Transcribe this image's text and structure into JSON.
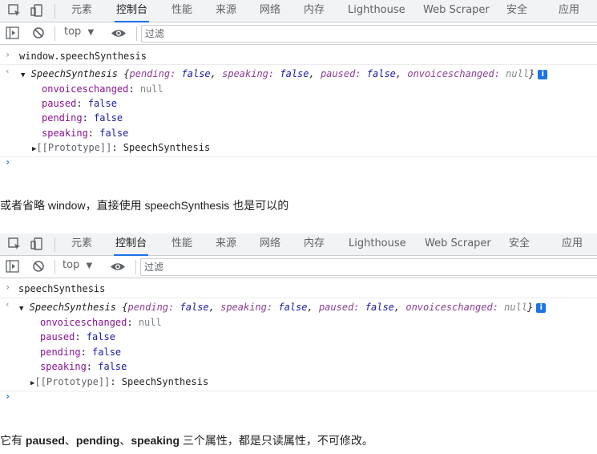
{
  "panels": [
    {
      "tabs": [
        "元素",
        "控制台",
        "性能",
        "来源",
        "网络",
        "内存",
        "Lighthouse",
        "Web Scraper",
        "安全",
        "应用"
      ],
      "active_tab": "控制台",
      "context": "top",
      "filter_placeholder": "过滤",
      "input": "window.speechSynthesis",
      "summary": {
        "class": "SpeechSynthesis",
        "open": "{",
        "pending_key": "pending:",
        "pending_val": "false",
        "speaking_key": "speaking:",
        "speaking_val": "false",
        "paused_key": "paused:",
        "paused_val": "false",
        "onvoices_key": "onvoiceschanged:",
        "onvoices_val": "null",
        "close": "}"
      },
      "props": [
        {
          "key": "onvoiceschanged",
          "value": "null"
        },
        {
          "key": "paused",
          "value": "false"
        },
        {
          "key": "pending",
          "value": "false"
        },
        {
          "key": "speaking",
          "value": "false"
        }
      ],
      "prototype_key": "[[Prototype]]",
      "prototype_val": "SpeechSynthesis"
    },
    {
      "tabs": [
        "元素",
        "控制台",
        "性能",
        "来源",
        "网络",
        "内存",
        "Lighthouse",
        "Web Scraper",
        "安全",
        "应用"
      ],
      "active_tab": "控制台",
      "context": "top",
      "filter_placeholder": "过滤",
      "input": "speechSynthesis",
      "summary": {
        "class": "SpeechSynthesis",
        "open": "{",
        "pending_key": "pending:",
        "pending_val": "false",
        "speaking_key": "speaking:",
        "speaking_val": "false",
        "paused_key": "paused:",
        "paused_val": "false",
        "onvoices_key": "onvoiceschanged:",
        "onvoices_val": "null",
        "close": "}"
      },
      "props": [
        {
          "key": "onvoiceschanged",
          "value": "null"
        },
        {
          "key": "paused",
          "value": "false"
        },
        {
          "key": "pending",
          "value": "false"
        },
        {
          "key": "speaking",
          "value": "false"
        }
      ],
      "prototype_key": "[[Prototype]]",
      "prototype_val": "SpeechSynthesis"
    }
  ],
  "text1": "或者省略 window，直接使用 speechSynthesis 也是可以的",
  "text2": {
    "prefix": "它有 ",
    "b1": "paused",
    "sep1": "、",
    "b2": "pending",
    "sep2": "、",
    "b3": "speaking",
    "suffix": " 三个属性，都是只读属性，不可修改。"
  },
  "colors": {
    "accent": "#1a73e8",
    "prop_name": "#881391",
    "keyword": "#1a1aa6",
    "null_value": "#80868b"
  }
}
